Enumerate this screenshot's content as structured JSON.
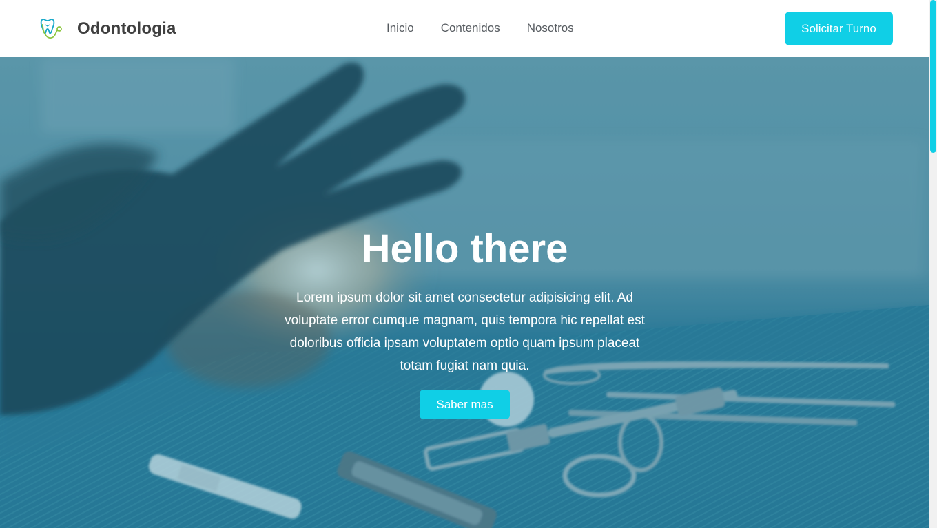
{
  "header": {
    "brand_name": "Odontologia",
    "logo_icon": "tooth-stethoscope-icon",
    "nav": [
      {
        "label": "Inicio"
      },
      {
        "label": "Contenidos"
      },
      {
        "label": "Nosotros"
      }
    ],
    "cta_label": "Solicitar Turno"
  },
  "hero": {
    "title": "Hello there",
    "text": "Lorem ipsum dolor sit amet consectetur adipisicing elit. Ad voluptate error cumque magnam, quis tempora hic repellat est doloribus officia ipsam voluptatem optio quam ipsum placeat totam fugiat nam quia.",
    "button_label": "Saber mas",
    "background": "dental-instruments-photo"
  },
  "colors": {
    "accent": "#10cfe6",
    "overlay": "#2f7f9c",
    "brand_text": "#3f3f3f"
  }
}
